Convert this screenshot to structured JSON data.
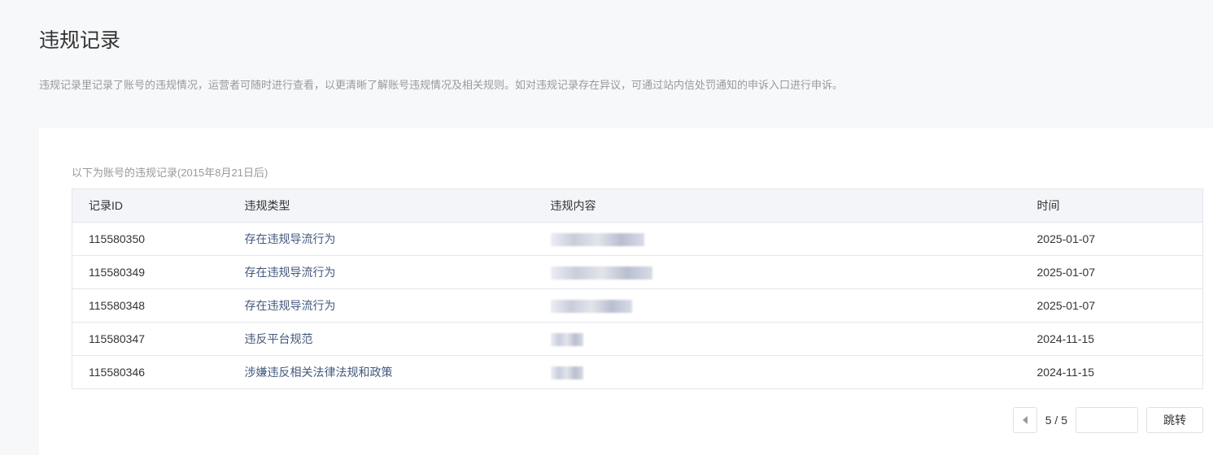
{
  "header": {
    "title": "违规记录",
    "description": "违规记录里记录了账号的违规情况，运营者可随时进行查看，以更清晰了解账号违规情况及相关规则。如对违规记录存在异议，可通过站内信处罚通知的申诉入口进行申诉。"
  },
  "card": {
    "subtitle": "以下为账号的违规记录(2015年8月21日后)"
  },
  "table": {
    "columns": [
      "记录ID",
      "违规类型",
      "违规内容",
      "时间"
    ],
    "rows": [
      {
        "id": "115580350",
        "type": "存在违规导流行为",
        "time": "2025-01-07"
      },
      {
        "id": "115580349",
        "type": "存在违规导流行为",
        "time": "2025-01-07"
      },
      {
        "id": "115580348",
        "type": "存在违规导流行为",
        "time": "2025-01-07"
      },
      {
        "id": "115580347",
        "type": "违反平台规范",
        "time": "2024-11-15"
      },
      {
        "id": "115580346",
        "type": "涉嫌违反相关法律法规和政策",
        "time": "2024-11-15"
      }
    ]
  },
  "pagination": {
    "page_text": "5 / 5",
    "jump_label": "跳转",
    "jump_value": ""
  }
}
